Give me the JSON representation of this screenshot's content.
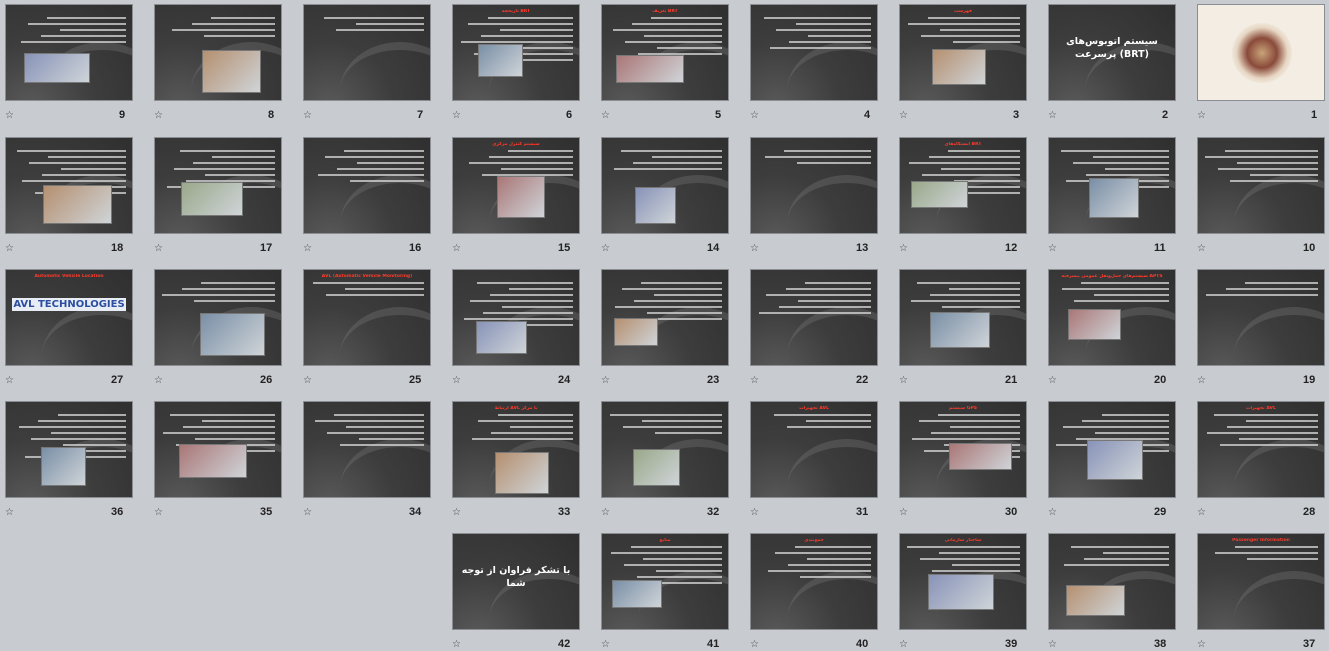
{
  "slides": [
    {
      "n": "1",
      "title": "",
      "big": "",
      "light": true
    },
    {
      "n": "2",
      "title": "",
      "big": "سیستم اتوبوس‌های پرسرعت (BRT)"
    },
    {
      "n": "3",
      "title": "فهرست"
    },
    {
      "n": "4",
      "title": ""
    },
    {
      "n": "5",
      "title": "تعریف BRT"
    },
    {
      "n": "6",
      "title": "تاریخچه BRT"
    },
    {
      "n": "7",
      "title": ""
    },
    {
      "n": "8",
      "title": ""
    },
    {
      "n": "9",
      "title": ""
    },
    {
      "n": "10",
      "title": ""
    },
    {
      "n": "11",
      "title": ""
    },
    {
      "n": "12",
      "title": "ایستگاه‌های BRT"
    },
    {
      "n": "13",
      "title": ""
    },
    {
      "n": "14",
      "title": ""
    },
    {
      "n": "15",
      "title": "سیستم کنترل مرکزی"
    },
    {
      "n": "16",
      "title": ""
    },
    {
      "n": "17",
      "title": ""
    },
    {
      "n": "18",
      "title": ""
    },
    {
      "n": "19",
      "title": ""
    },
    {
      "n": "20",
      "title": "سیستم‌های حمل‌ونقل عمومی پیشرفته APTS"
    },
    {
      "n": "21",
      "title": ""
    },
    {
      "n": "22",
      "title": ""
    },
    {
      "n": "23",
      "title": ""
    },
    {
      "n": "24",
      "title": ""
    },
    {
      "n": "25",
      "title": "AVL (Automatic Vehicle Monitoring)"
    },
    {
      "n": "26",
      "title": ""
    },
    {
      "n": "27",
      "title": "Automatic Vehicle Location",
      "big": "AVL TECHNOLOGIES"
    },
    {
      "n": "28",
      "title": "تجهیزات AVL"
    },
    {
      "n": "29",
      "title": ""
    },
    {
      "n": "30",
      "title": "سیستم GPS"
    },
    {
      "n": "31",
      "title": "تجهیزات AVL"
    },
    {
      "n": "32",
      "title": ""
    },
    {
      "n": "33",
      "title": "ارتباط AVL با مرکز"
    },
    {
      "n": "34",
      "title": ""
    },
    {
      "n": "35",
      "title": ""
    },
    {
      "n": "36",
      "title": ""
    },
    {
      "n": "37",
      "title": "Passenger Information"
    },
    {
      "n": "38",
      "title": ""
    },
    {
      "n": "39",
      "title": "ساختار سازمانی"
    },
    {
      "n": "40",
      "title": "جمع‌بندی"
    },
    {
      "n": "41",
      "title": "منابع"
    },
    {
      "n": "42",
      "title": "",
      "big": "با تشکر فراوان از توجه شما"
    }
  ],
  "star_glyph": "☆"
}
